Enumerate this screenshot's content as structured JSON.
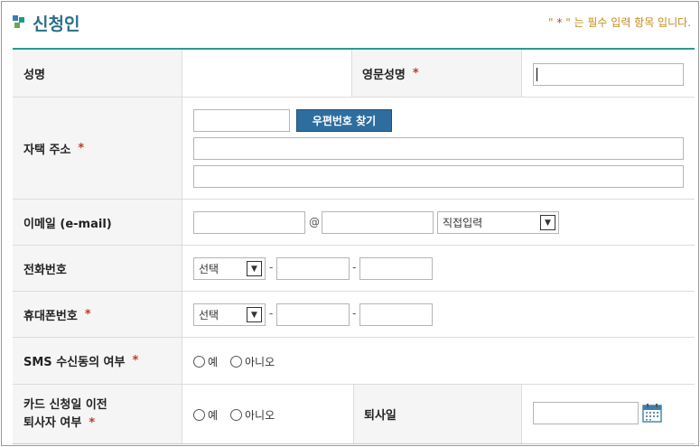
{
  "header": {
    "title": "신청인",
    "required_note_prefix": "\" ",
    "required_note_star": "*",
    "required_note_suffix": " \" 는 필수 입력 항목 입니다."
  },
  "rows": {
    "name": {
      "label": "성명",
      "english_label": "영문성명",
      "required_star": "*"
    },
    "address": {
      "label": "자택 주소",
      "required_star": "*",
      "postcode_button": "우편번호 찾기"
    },
    "email": {
      "label": "이메일 (e-mail)",
      "at": "@",
      "domain_select": "직접입력"
    },
    "phone": {
      "label": "전화번호",
      "select": "선택",
      "dash": "-"
    },
    "mobile": {
      "label": "휴대폰번호",
      "required_star": "*",
      "select": "선택",
      "dash": "-"
    },
    "sms": {
      "label": "SMS 수신동의 여부",
      "required_star": "*",
      "yes": "예",
      "no": "아니오"
    },
    "resigned": {
      "label_line1": "카드 신청일 이전",
      "label_line2": "퇴사자 여부",
      "required_star": "*",
      "yes": "예",
      "no": "아니오",
      "date_label": "퇴사일"
    }
  },
  "icons": {
    "select_arrow": "chevron-down-icon",
    "calendar": "calendar-icon"
  },
  "colors": {
    "title": "#2a6f88",
    "rule": "#2a9a93",
    "button": "#2e6e9e",
    "required": "#c0392b"
  }
}
